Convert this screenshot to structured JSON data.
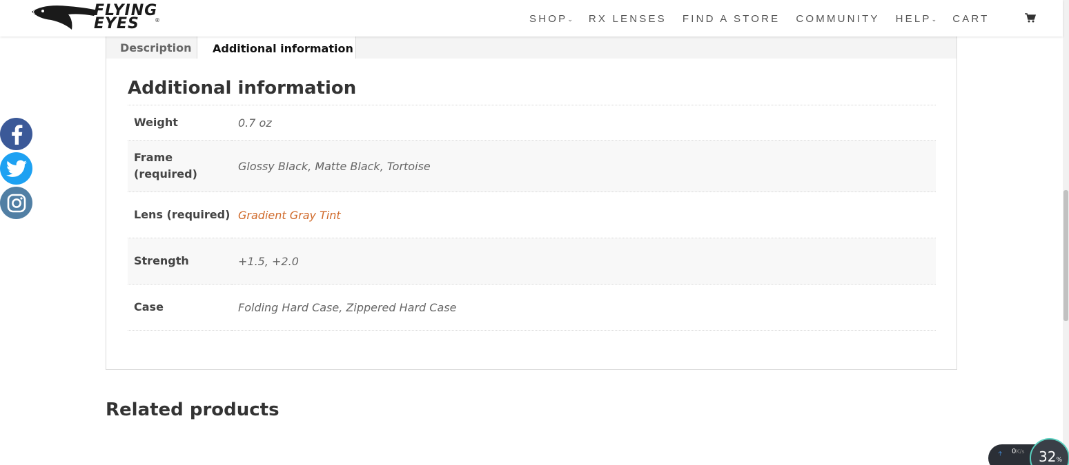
{
  "header": {
    "logo": {
      "line1": "FLYING",
      "line2": "EYES",
      "mark": "®"
    },
    "nav": [
      {
        "label": "SHOP",
        "dropdown": true
      },
      {
        "label": "RX LENSES",
        "dropdown": false
      },
      {
        "label": "FIND A STORE",
        "dropdown": false
      },
      {
        "label": "COMMUNITY",
        "dropdown": false
      },
      {
        "label": "HELP",
        "dropdown": true
      },
      {
        "label": "CART",
        "dropdown": false
      }
    ],
    "cart_icon": "shopping-cart-icon"
  },
  "social": [
    "facebook-icon",
    "twitter-icon",
    "instagram-icon"
  ],
  "tabs": [
    {
      "label": "Description",
      "active": false
    },
    {
      "label": "Additional information",
      "active": true
    }
  ],
  "panel": {
    "title": "Additional information",
    "rows": [
      {
        "label": "Weight",
        "value": "0.7 oz"
      },
      {
        "label": "Frame (required)",
        "value": "Glossy Black, Matte Black, Tortoise"
      },
      {
        "label": "Lens (required)",
        "value": "Gradient Gray Tint"
      },
      {
        "label": "Strength",
        "value": "+1.5, +2.0"
      },
      {
        "label": "Case",
        "value": "Folding Hard Case, Zippered Hard Case"
      }
    ]
  },
  "related_title": "Related products",
  "speed_widget": {
    "upload": "0",
    "unit": "K/s",
    "percent": "32",
    "percent_sign": "%"
  },
  "colors": {
    "accent_link": "#d06b2c",
    "facebook": "#3b5998",
    "twitter": "#1da1f2",
    "instagram": "#517fa4"
  }
}
